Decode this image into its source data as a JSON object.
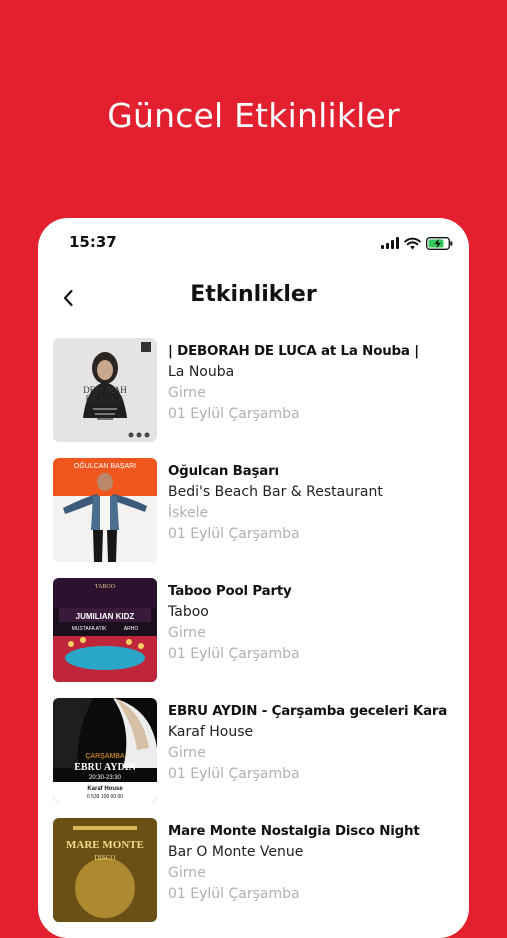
{
  "colors": {
    "brand": "#e3202f",
    "card": "#ffffff",
    "muted": "#b0b0b0",
    "text": "#111111"
  },
  "promo": {
    "heading": "Güncel Etkinlikler"
  },
  "status_bar": {
    "time": "15:37",
    "icons": [
      "signal-icon",
      "wifi-icon",
      "battery-charging-icon"
    ]
  },
  "nav": {
    "back_icon": "chevron-left-icon",
    "title": "Etkinlikler"
  },
  "events": [
    {
      "title": "| DEBORAH DE LUCA at La Nouba |",
      "venue": "La Nouba",
      "city": "Girne",
      "date": "01 Eylül Çarşamba",
      "poster_text": [
        "DEBORAH",
        "DE LUCA"
      ]
    },
    {
      "title": "Oğulcan Başarı",
      "venue": "Bedi's Beach Bar & Restaurant",
      "city": "İskele",
      "date": "01 Eylül Çarşamba",
      "poster_text": [
        "OĞULCAN BAŞARI"
      ]
    },
    {
      "title": "Taboo Pool Party",
      "venue": "Taboo",
      "city": "Girne",
      "date": "01 Eylül Çarşamba",
      "poster_text": [
        "TABOO",
        "JUMILIAN KIDZ",
        "MUSTAFA ATIK",
        "ARHO"
      ]
    },
    {
      "title": "EBRU AYDIN - Çarşamba geceleri Kara",
      "venue": "Karaf House",
      "city": "Girne",
      "date": "01 Eylül Çarşamba",
      "poster_text": [
        "ÇARŞAMBA",
        "EBRU AYDIN",
        "20:30-23:30",
        "Karaf House",
        "0 539 109 00 00"
      ]
    },
    {
      "title": "Mare Monte Nostalgia Disco Night",
      "venue": "Bar O Monte Venue",
      "city": "Girne",
      "date": "01 Eylül Çarşamba",
      "poster_text": [
        "MARE MONTE",
        "DISCO"
      ]
    }
  ]
}
